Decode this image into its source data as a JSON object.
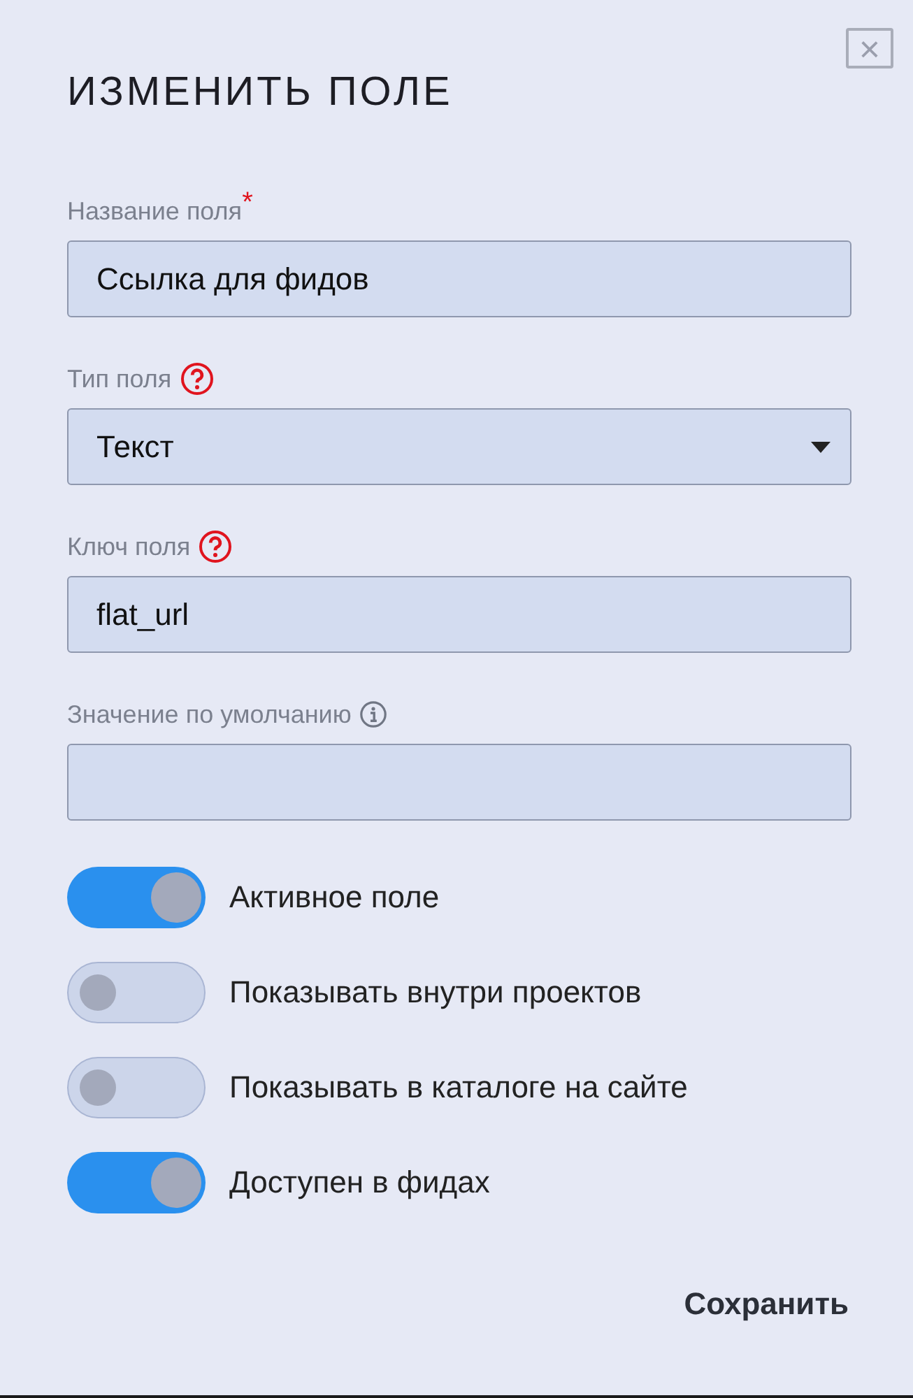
{
  "dialog": {
    "title": "ИЗМЕНИТЬ ПОЛЕ",
    "close_button": "×"
  },
  "fields": [
    {
      "kind": "text",
      "label": "Название поля",
      "required_mark": "*",
      "value": "Ссылка для фидов"
    },
    {
      "kind": "select",
      "label": "Тип поля",
      "help_icon": true,
      "value": "Текст"
    },
    {
      "kind": "text",
      "label": "Ключ поля",
      "help_icon": true,
      "value": "flat_url"
    },
    {
      "kind": "text",
      "label": "Значение по умолчанию",
      "info_icon": true
    }
  ],
  "toggles": [
    {
      "label": "Активное поле",
      "on": true
    },
    {
      "label": "Показывать внутри проектов",
      "on": false
    },
    {
      "label": "Показывать в каталоге на сайте",
      "on": false
    },
    {
      "label": "Доступен в фидах",
      "on": true
    }
  ],
  "save_button": "Сохранить"
}
